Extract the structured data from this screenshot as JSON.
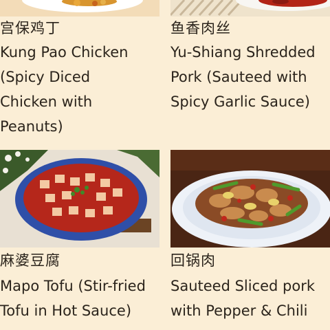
{
  "dishes": [
    {
      "name_zh": "宫保鸡丁",
      "name_en": [
        "Kung Pao Chicken",
        "(Spicy Diced",
        "Chicken with",
        "Peanuts)"
      ]
    },
    {
      "name_zh": "鱼香肉丝",
      "name_en": [
        "Yu-Shiang Shredded",
        "Pork (Sauteed with",
        "Spicy Garlic Sauce)"
      ]
    },
    {
      "name_zh": "麻婆豆腐",
      "name_en": [
        "Mapo Tofu (Stir-fried",
        "Tofu in Hot Sauce)"
      ]
    },
    {
      "name_zh": "回锅肉",
      "name_en": [
        "Sauteed Sliced pork",
        "with Pepper & Chili"
      ]
    }
  ],
  "colors": {
    "background": "#fbeed6",
    "text": "#2b241c",
    "tofu_bowl": "#2f4fa8",
    "sauce": "#c0281c"
  }
}
